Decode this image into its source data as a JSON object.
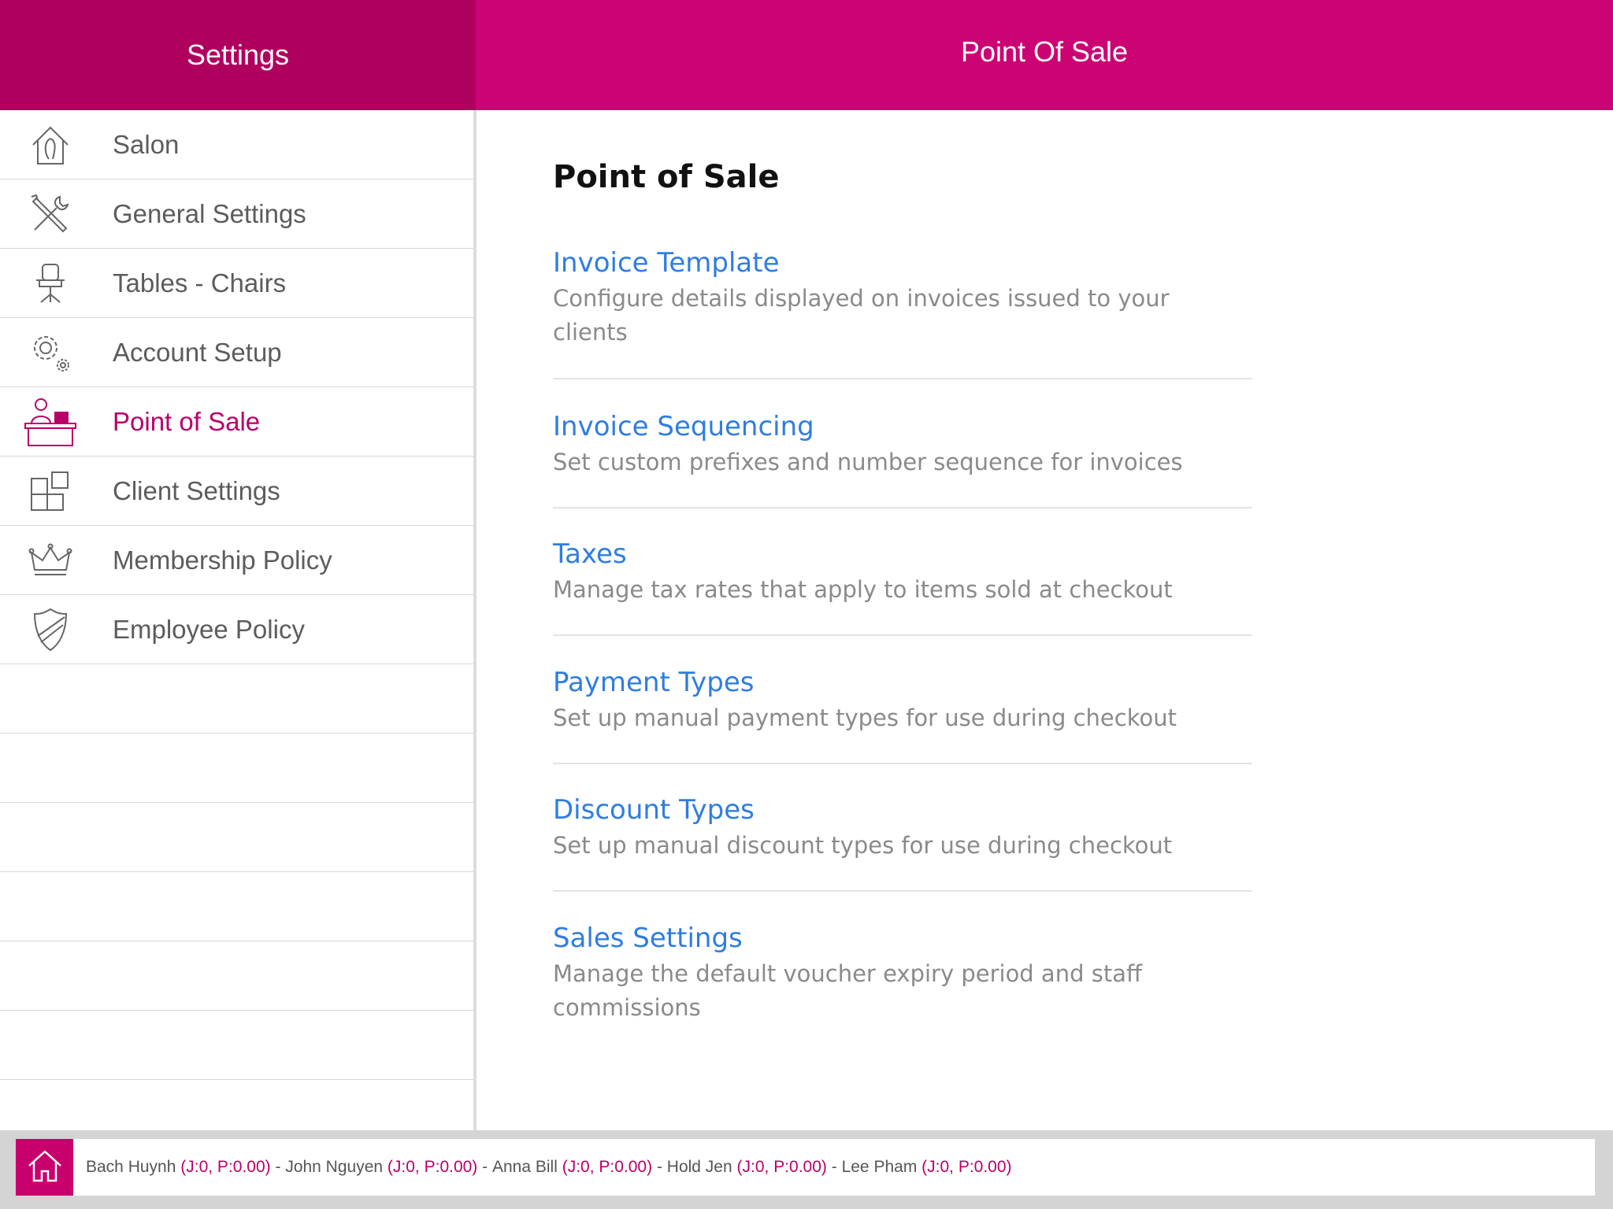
{
  "header": {
    "left_title": "Settings",
    "right_title": "Point Of Sale"
  },
  "sidebar": {
    "items": [
      {
        "label": "Salon",
        "icon": "salon-icon"
      },
      {
        "label": "General Settings",
        "icon": "tools-icon"
      },
      {
        "label": "Tables - Chairs",
        "icon": "chair-icon"
      },
      {
        "label": "Account Setup",
        "icon": "gears-icon"
      },
      {
        "label": "Point of Sale",
        "icon": "cashier-icon",
        "active": true
      },
      {
        "label": "Client Settings",
        "icon": "grid-icon"
      },
      {
        "label": "Membership Policy",
        "icon": "crown-icon"
      },
      {
        "label": "Employee Policy",
        "icon": "shield-icon"
      }
    ]
  },
  "main": {
    "title": "Point of Sale",
    "options": [
      {
        "title": "Invoice Template",
        "desc_lines": [
          "Configure details displayed on invoices issued to your",
          "clients"
        ]
      },
      {
        "title": "Invoice Sequencing",
        "desc_lines": [
          "Set custom prefixes and number sequence for invoices"
        ]
      },
      {
        "title": "Taxes",
        "desc_lines": [
          "Manage tax rates that apply to items sold at checkout"
        ]
      },
      {
        "title": "Payment Types",
        "desc_lines": [
          "Set up manual payment types for use during checkout"
        ]
      },
      {
        "title": "Discount Types",
        "desc_lines": [
          "Set up manual discount types for use during checkout"
        ]
      },
      {
        "title": "Sales Settings",
        "desc_lines": [
          "Manage the default voucher expiry period and staff",
          "commissions"
        ]
      }
    ]
  },
  "bottom": {
    "staff": [
      {
        "name": "Bach Huynh",
        "stat": "(J:0, P:0.00)"
      },
      {
        "name": "John Nguyen",
        "stat": "(J:0, P:0.00)"
      },
      {
        "name": "Anna Bill",
        "stat": "(J:0, P:0.00)"
      },
      {
        "name": "Hold Jen",
        "stat": "(J:0, P:0.00)"
      },
      {
        "name": "Lee Pham",
        "stat": "(J:0, P:0.00)"
      }
    ],
    "separator": " - "
  },
  "colors": {
    "header_left": "#b0005e",
    "header_right": "#cc0473",
    "accent": "#b8006a",
    "link": "#2f7de1"
  }
}
